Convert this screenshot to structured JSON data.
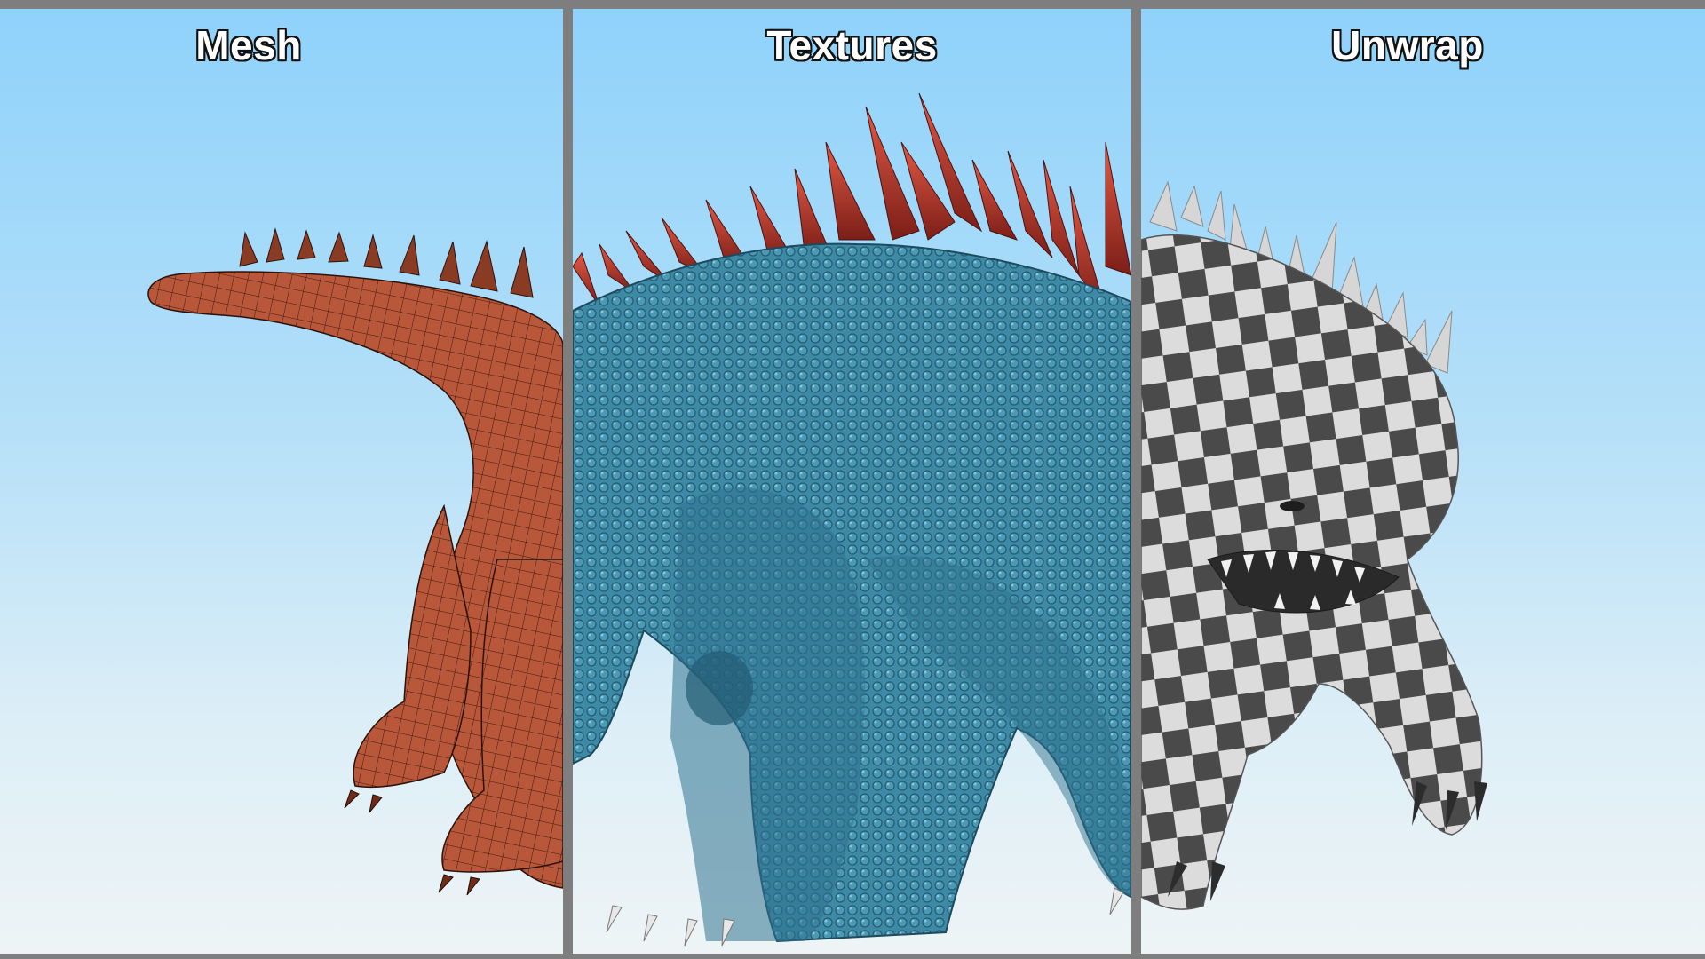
{
  "panels": [
    {
      "label": "Mesh"
    },
    {
      "label": "Textures"
    },
    {
      "label": "Unwrap"
    }
  ],
  "colors": {
    "frame": "#7e7e7e",
    "sky_top": "#8fd2fb",
    "sky_bottom": "#eef4f6",
    "mesh": "#b9573a",
    "skin": "#3d8aa6",
    "spikes": "#c0392b",
    "checker_dark": "#4a4a4a",
    "checker_light": "#dcdcdc"
  }
}
